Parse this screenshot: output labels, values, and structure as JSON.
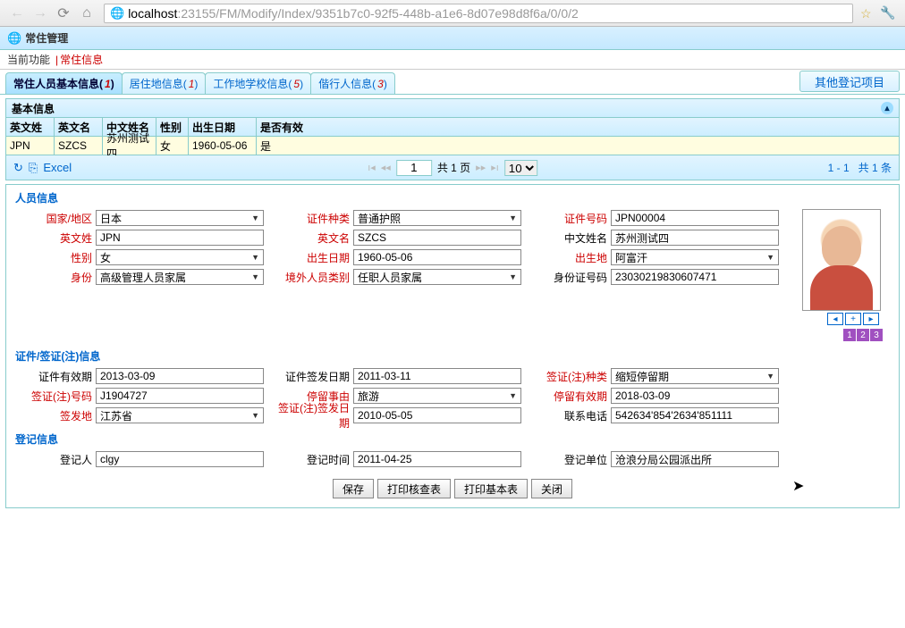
{
  "browser": {
    "url_host": "localhost",
    "url_rest": ":23155/FM/Modify/Index/9351b7c0-92f5-448b-a1e6-8d07e98d8f6a/0/0/2"
  },
  "title": "常住管理",
  "breadcrumb": {
    "label": "当前功能",
    "current": "常住信息"
  },
  "tabs": [
    {
      "label": "常住人员基本信息",
      "count": "1",
      "active": true
    },
    {
      "label": "居住地信息",
      "count": "1",
      "active": false
    },
    {
      "label": "工作地学校信息",
      "count": "5",
      "active": false
    },
    {
      "label": "偕行人信息",
      "count": "3",
      "active": false
    }
  ],
  "other_register_label": "其他登记项目",
  "section_basic": "基本信息",
  "grid": {
    "headers": [
      "英文姓",
      "英文名",
      "中文姓名",
      "性别",
      "出生日期",
      "是否有效"
    ],
    "row": [
      "JPN",
      "SZCS",
      "苏州测试四",
      "女",
      "1960-05-06",
      "是"
    ]
  },
  "pager": {
    "refresh": "↻",
    "excel": "Excel",
    "page_input": "1",
    "page_total": "共 1 页",
    "page_size": "10",
    "summary_a": "1 - 1",
    "summary_b": "共 1 条"
  },
  "form": {
    "s1": "人员信息",
    "s2": "证件/签证(注)信息",
    "s3": "登记信息",
    "fields": {
      "country": {
        "label": "国家/地区",
        "val": "日本",
        "req": true,
        "sel": true
      },
      "eng_last": {
        "label": "英文姓",
        "val": "JPN",
        "req": true
      },
      "gender": {
        "label": "性别",
        "val": "女",
        "req": true,
        "sel": true
      },
      "identity": {
        "label": "身份",
        "val": "高级管理人员家属",
        "req": true,
        "sel": true
      },
      "cert_type": {
        "label": "证件种类",
        "val": "普通护照",
        "req": true,
        "sel": true
      },
      "eng_first": {
        "label": "英文名",
        "val": "SZCS",
        "req": true
      },
      "birth": {
        "label": "出生日期",
        "val": "1960-05-06",
        "req": true
      },
      "overseas": {
        "label": "境外人员类别",
        "val": "任职人员家属",
        "req": true,
        "sel": true
      },
      "cert_no": {
        "label": "证件号码",
        "val": "JPN00004",
        "req": true
      },
      "cn_name": {
        "label": "中文姓名",
        "val": "苏州测试四"
      },
      "birth_place": {
        "label": "出生地",
        "val": "阿富汗",
        "req": true,
        "sel": true
      },
      "id_no": {
        "label": "身份证号码",
        "val": "23030219830607471"
      },
      "cert_valid": {
        "label": "证件有效期",
        "val": "2013-03-09"
      },
      "visa_no": {
        "label": "签证(注)号码",
        "val": "J1904727",
        "req": true
      },
      "issue_place": {
        "label": "签发地",
        "val": "江苏省",
        "req": true,
        "sel": true
      },
      "cert_issue": {
        "label": "证件签发日期",
        "val": "2011-03-11"
      },
      "stay_reason": {
        "label": "停留事由",
        "val": "旅游",
        "req": true,
        "sel": true
      },
      "visa_issue": {
        "label": "签证(注)签发日期",
        "val": "2010-05-05",
        "req": true
      },
      "visa_type": {
        "label": "签证(注)种类",
        "val": "缩短停留期",
        "req": true,
        "sel": true
      },
      "stay_valid": {
        "label": "停留有效期",
        "val": "2018-03-09",
        "req": true
      },
      "phone": {
        "label": "联系电话",
        "val": "542634'854'2634'851111"
      },
      "reg_person": {
        "label": "登记人",
        "val": "clgy"
      },
      "reg_time": {
        "label": "登记时间",
        "val": "2011-04-25"
      },
      "reg_unit": {
        "label": "登记单位",
        "val": "沧浪分局公园派出所"
      }
    }
  },
  "photo_pages": [
    "1",
    "2",
    "3"
  ],
  "buttons": {
    "save": "保存",
    "print_check": "打印核查表",
    "print_basic": "打印基本表",
    "close": "关闭"
  }
}
